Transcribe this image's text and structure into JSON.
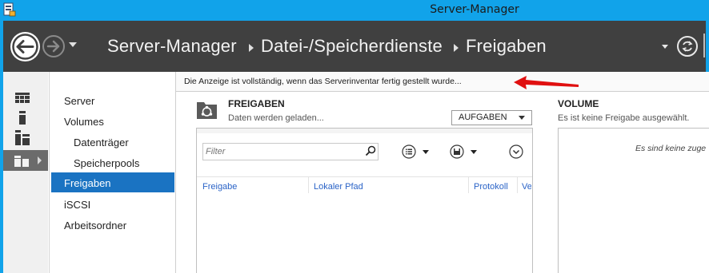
{
  "window": {
    "title": "Server-Manager"
  },
  "breadcrumb": {
    "items": [
      "Server-Manager",
      "Datei-/Speicherdienste",
      "Freigaben"
    ]
  },
  "nav": {
    "items": [
      {
        "label": "Server"
      },
      {
        "label": "Volumes"
      },
      {
        "label": "Datenträger"
      },
      {
        "label": "Speicherpools"
      },
      {
        "label": "Freigaben",
        "active": true
      },
      {
        "label": "iSCSI"
      },
      {
        "label": "Arbeitsordner"
      }
    ]
  },
  "banner": {
    "text": "Die Anzeige ist vollständig, wenn das Serverinventar fertig gestellt wurde..."
  },
  "shares": {
    "title": "FREIGABEN",
    "status": "Daten werden geladen...",
    "tasks_label": "AUFGABEN",
    "filter_placeholder": "Filter",
    "columns": [
      "Freigabe",
      "Lokaler Pfad",
      "Protokoll",
      "Ve"
    ]
  },
  "volume": {
    "title": "VOLUME",
    "status": "Es ist keine Freigabe ausgewählt.",
    "empty_text": "Es sind keine zuge"
  },
  "icons": [
    "app-icon",
    "back-icon",
    "forward-icon",
    "refresh-icon",
    "dashboard-icon",
    "local-server-icon",
    "all-servers-icon",
    "file-services-icon",
    "shares-icon",
    "search-icon",
    "list-view-icon",
    "save-icon",
    "expand-icon"
  ],
  "colors": {
    "titlebar": "#11a3ea",
    "header": "#404040",
    "accent": "#1a73c2",
    "annotation_arrow": "#e01010"
  }
}
